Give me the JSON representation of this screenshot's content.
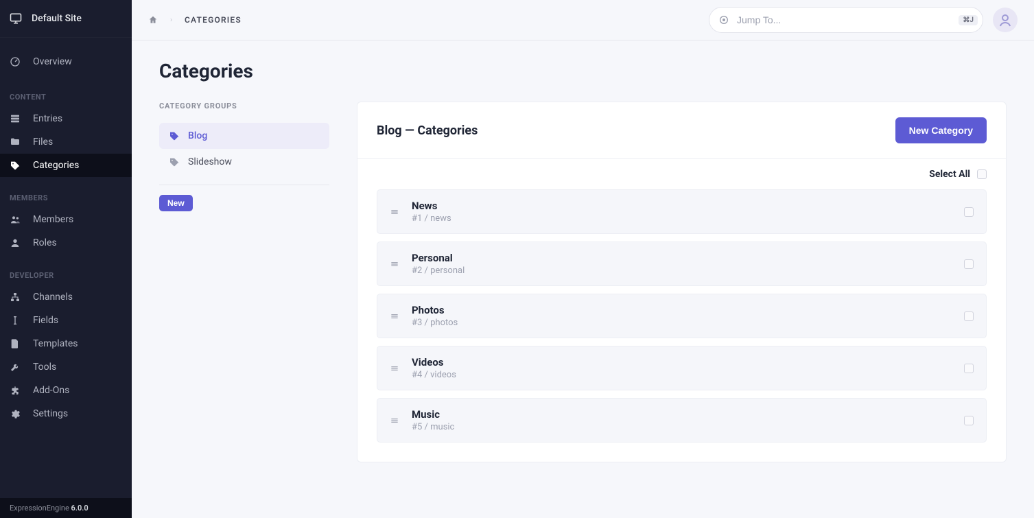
{
  "site_name": "Default Site",
  "sidebar": {
    "overview": "Overview",
    "sections": [
      {
        "label": "CONTENT",
        "items": [
          {
            "key": "entries",
            "label": "Entries",
            "icon": "list"
          },
          {
            "key": "files",
            "label": "Files",
            "icon": "folder"
          },
          {
            "key": "categories",
            "label": "Categories",
            "icon": "tag",
            "active": true
          }
        ]
      },
      {
        "label": "MEMBERS",
        "items": [
          {
            "key": "members",
            "label": "Members",
            "icon": "users"
          },
          {
            "key": "roles",
            "label": "Roles",
            "icon": "user"
          }
        ]
      },
      {
        "label": "DEVELOPER",
        "items": [
          {
            "key": "channels",
            "label": "Channels",
            "icon": "sitemap"
          },
          {
            "key": "fields",
            "label": "Fields",
            "icon": "textcursor"
          },
          {
            "key": "templates",
            "label": "Templates",
            "icon": "file"
          },
          {
            "key": "tools",
            "label": "Tools",
            "icon": "wrench"
          },
          {
            "key": "addons",
            "label": "Add-Ons",
            "icon": "puzzle"
          },
          {
            "key": "settings",
            "label": "Settings",
            "icon": "gear"
          }
        ]
      }
    ]
  },
  "footer": {
    "brand": "ExpressionEngine",
    "version": "6.0.0"
  },
  "breadcrumb": {
    "current": "CATEGORIES"
  },
  "jump": {
    "placeholder": "Jump To...",
    "shortcut": "⌘J"
  },
  "page_title": "Categories",
  "groups": {
    "heading": "CATEGORY GROUPS",
    "items": [
      {
        "label": "Blog",
        "active": true
      },
      {
        "label": "Slideshow",
        "active": false
      }
    ],
    "new_label": "New"
  },
  "panel": {
    "title": "Blog — Categories",
    "new_button": "New Category",
    "select_all": "Select All",
    "categories": [
      {
        "name": "News",
        "meta": "#1 / news"
      },
      {
        "name": "Personal",
        "meta": "#2 / personal"
      },
      {
        "name": "Photos",
        "meta": "#3 / photos"
      },
      {
        "name": "Videos",
        "meta": "#4 / videos"
      },
      {
        "name": "Music",
        "meta": "#5 / music"
      }
    ]
  },
  "colors": {
    "accent": "#5d5bd4",
    "sidebar_bg": "#1a1d2e"
  }
}
